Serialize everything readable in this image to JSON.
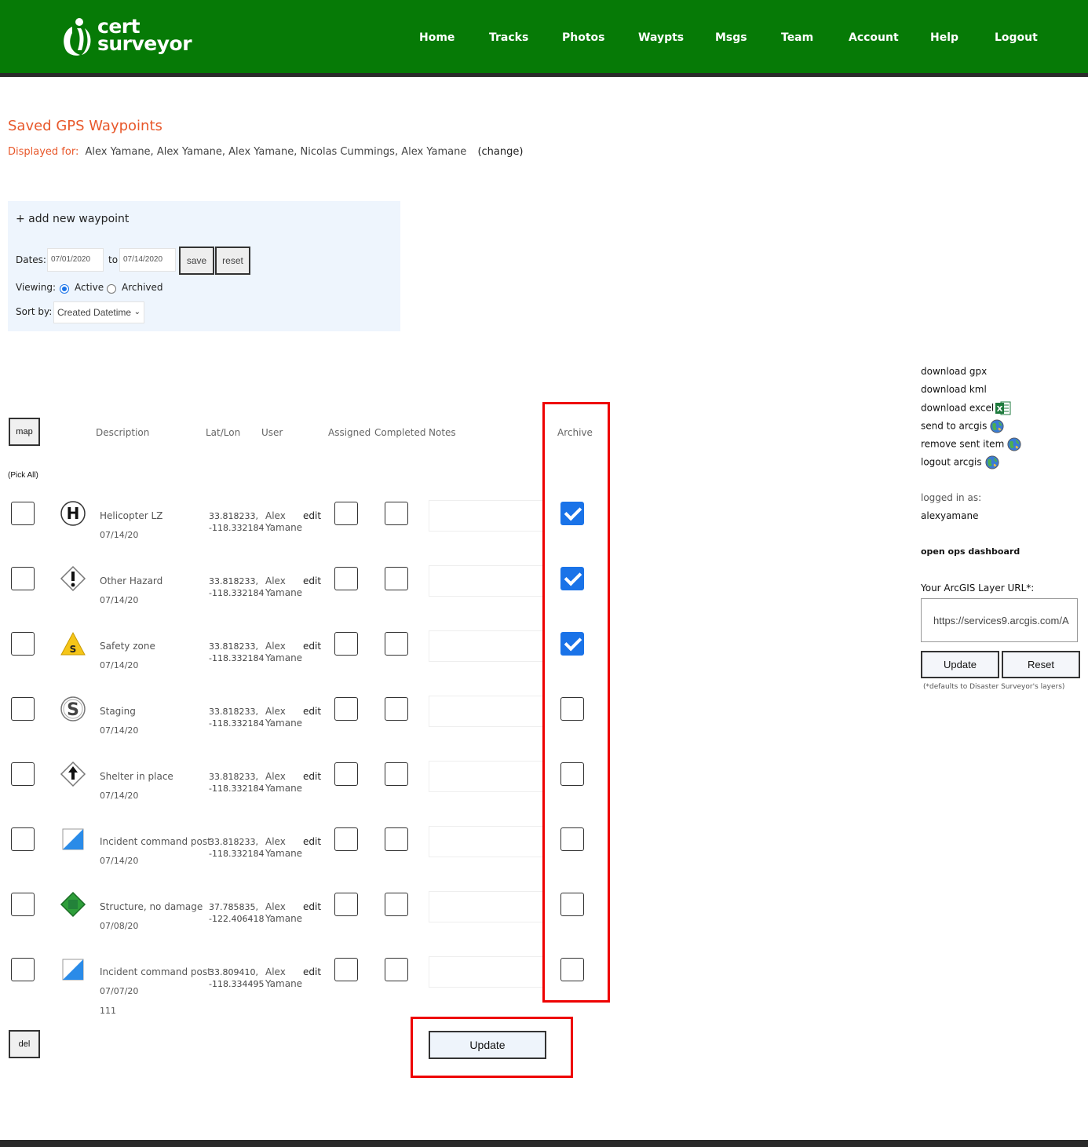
{
  "brand": {
    "line1": "cert",
    "line2": "surveyor",
    "color": "#067a06"
  },
  "nav": [
    {
      "label": "Home"
    },
    {
      "label": "Tracks"
    },
    {
      "label": "Photos"
    },
    {
      "label": "Waypts"
    },
    {
      "label": "Msgs"
    },
    {
      "label": "Team"
    },
    {
      "label": "Account"
    },
    {
      "label": "Help"
    },
    {
      "label": "Logout"
    }
  ],
  "page": {
    "title": "Saved GPS Waypoints",
    "displayed_for_label": "Displayed for:",
    "displayed_for_names": "Alex Yamane, Alex Yamane, Alex Yamane, Nicolas Cummings, Alex Yamane",
    "change_link": "(change)"
  },
  "filter": {
    "add_waypoint": "+ add new waypoint",
    "dates_label": "Dates:",
    "date_from": "07/01/2020",
    "to_label": "to",
    "date_to": "07/14/2020",
    "save_label": "save",
    "reset_label": "reset",
    "viewing_label": "Viewing:",
    "viewing_active": "Active",
    "viewing_archived": "Archived",
    "viewing_selected": "Active",
    "sortby_label": "Sort by:",
    "sortby_value": "Created Datetime"
  },
  "table": {
    "map_button": "map",
    "pick_all": "(Pick All)",
    "headers": {
      "description": "Description",
      "latlon": "Lat/Lon",
      "user": "User",
      "assigned": "Assigned",
      "completed": "Completed",
      "notes": "Notes",
      "archive": "Archive"
    },
    "edit_label": "edit",
    "rows": [
      {
        "icon": "helicopter-icon",
        "description": "Helicopter LZ",
        "date": "07/14/20",
        "extra": "",
        "lat": "33.818233,",
        "lon": "-118.332184",
        "user1": "Alex",
        "user2": "Yamane",
        "archived": true
      },
      {
        "icon": "hazard-icon",
        "description": "Other Hazard",
        "date": "07/14/20",
        "extra": "",
        "lat": "33.818233,",
        "lon": "-118.332184",
        "user1": "Alex",
        "user2": "Yamane",
        "archived": true
      },
      {
        "icon": "safety-zone-icon",
        "description": "Safety zone",
        "date": "07/14/20",
        "extra": "",
        "lat": "33.818233,",
        "lon": "-118.332184",
        "user1": "Alex",
        "user2": "Yamane",
        "archived": true
      },
      {
        "icon": "staging-icon",
        "description": "Staging",
        "date": "07/14/20",
        "extra": "",
        "lat": "33.818233,",
        "lon": "-118.332184",
        "user1": "Alex",
        "user2": "Yamane",
        "archived": false
      },
      {
        "icon": "shelter-icon",
        "description": "Shelter in place",
        "date": "07/14/20",
        "extra": "",
        "lat": "33.818233,",
        "lon": "-118.332184",
        "user1": "Alex",
        "user2": "Yamane",
        "archived": false
      },
      {
        "icon": "command-post-icon",
        "description": "Incident command post",
        "date": "07/14/20",
        "extra": "",
        "lat": "33.818233,",
        "lon": "-118.332184",
        "user1": "Alex",
        "user2": "Yamane",
        "archived": false
      },
      {
        "icon": "structure-icon",
        "description": "Structure, no damage",
        "date": "07/08/20",
        "extra": "",
        "lat": "37.785835,",
        "lon": "-122.406418",
        "user1": "Alex",
        "user2": "Yamane",
        "archived": false
      },
      {
        "icon": "command-post-icon",
        "description": "Incident command post",
        "date": "07/07/20",
        "extra": "111",
        "lat": "33.809410,",
        "lon": "-118.334495",
        "user1": "Alex",
        "user2": "Yamane",
        "archived": false
      }
    ],
    "del_button": "del",
    "update_button": "Update"
  },
  "sidebar": {
    "links": [
      {
        "label": "download gpx",
        "icon": ""
      },
      {
        "label": "download kml",
        "icon": ""
      },
      {
        "label": "download excel",
        "icon": "excel-icon"
      },
      {
        "label": "send to arcgis",
        "icon": "globe-icon"
      },
      {
        "label": "remove sent item",
        "icon": "globe-icon"
      },
      {
        "label": "logout arcgis",
        "icon": "globe-icon"
      }
    ],
    "logged_in_label": "logged in as:",
    "username": "alexyamane",
    "dashboard_link": "open ops dashboard",
    "arcgis_label": "Your ArcGIS Layer URL*:",
    "arcgis_url": "https://services9.arcgis.com/A",
    "update_label": "Update",
    "reset_label": "Reset",
    "footnote": "(*defaults to Disaster Surveyor's layers)"
  }
}
